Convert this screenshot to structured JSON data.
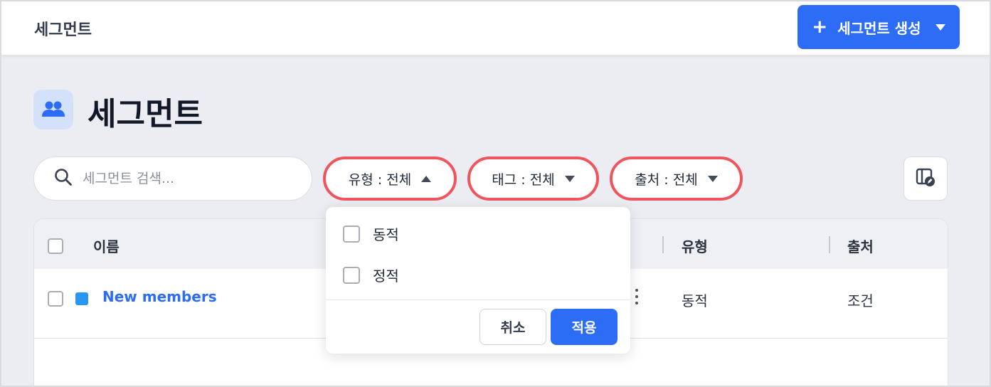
{
  "header": {
    "title": "세그먼트",
    "create_button": {
      "plus": "+",
      "label": "세그먼트 생성"
    }
  },
  "page": {
    "title": "세그먼트"
  },
  "search": {
    "placeholder": "세그먼트 검색..."
  },
  "filters": [
    {
      "label": "유형 : 전체",
      "state": "open"
    },
    {
      "label": "태그 : 전체",
      "state": "closed"
    },
    {
      "label": "출처 : 전체",
      "state": "closed"
    }
  ],
  "type_dropdown": {
    "options": [
      "동적",
      "정적"
    ],
    "cancel_label": "취소",
    "apply_label": "적용"
  },
  "table": {
    "columns": [
      "이름",
      "유형",
      "출처"
    ],
    "rows": [
      {
        "name": "New members",
        "type": "동적",
        "source": "조건",
        "color": "#2996ef"
      }
    ]
  },
  "colors": {
    "accent": "#2d6df6",
    "highlight_border": "#f0555e",
    "background": "#ecedf2"
  }
}
